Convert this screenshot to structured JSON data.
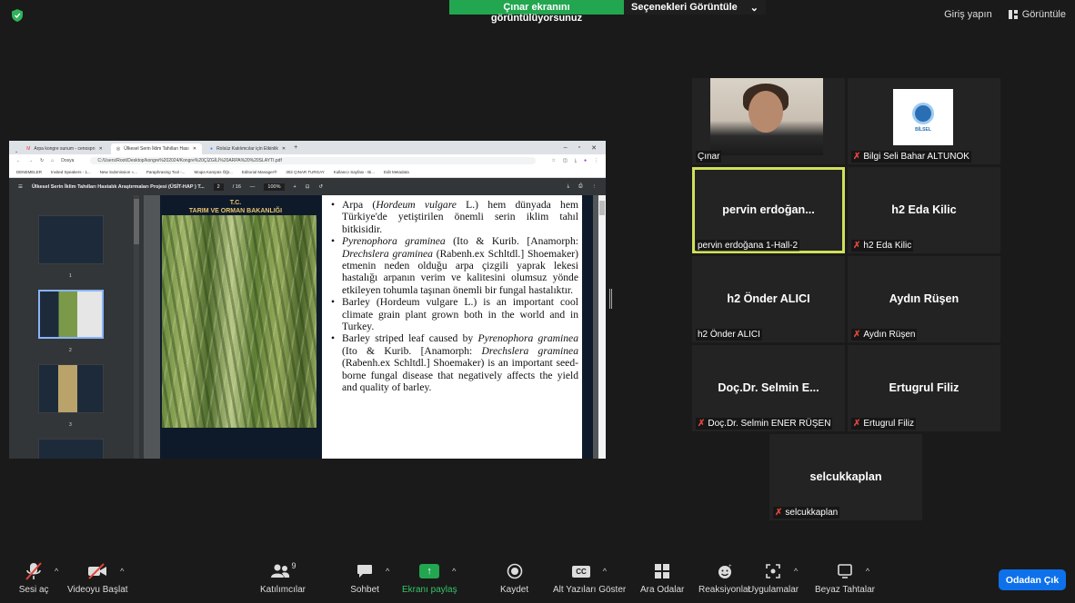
{
  "top": {
    "sharing_banner": "Çınar ekranını görüntülüyorsunuz",
    "view_options": "Seçenekleri Görüntüle",
    "sign_in": "Giriş yapın",
    "view": "Görüntüle"
  },
  "browser": {
    "tabs": [
      "Arpa kongre sunum - cenosprı",
      "Ülkesel Serin İklim Tahılları Hası",
      "Rolsüz Katılımcılar için Etkinlik"
    ],
    "address_label": "Dosya",
    "url": "C:/Users/Root/Desktop/kongre%202024/Kongre%20ÇİZGİLİ%20ARPA%20%20SLAYTI.pdf",
    "bookmarks": [
      "DENEMELER",
      "Invited Speakers - 1...",
      "New Submission «...",
      "Paraphrasing Tool -...",
      "Moqia Kampüs Öğr...",
      "Editorial Manager®",
      "302 ÇINAR TURGAY",
      "Kullanıcı Sayfası - Bi...",
      "Edit Metadata"
    ]
  },
  "pdf": {
    "title": "Ülkesel Serin İklim Tahılları Hastalık Araştırmaları Projesi (ÜSİT-HAP ) T...",
    "page": "2",
    "total": "/ 16",
    "zoom": "100%",
    "thumb_numbers": [
      "1",
      "2",
      "3"
    ]
  },
  "slide": {
    "header_line1": "T.C.",
    "header_line2": "TARIM VE ORMAN BAKANLIĞI",
    "bullets": [
      [
        "Arpa (",
        "Hordeum vulgare",
        " L.) hem dünyada hem Türkiye'de yetiştirilen önemli serin iklim tahıl bitkisidir."
      ],
      [
        "",
        "Pyrenophora graminea",
        " (Ito & Kurib. [Anamorph: ",
        "Drechslera graminea",
        " (Rabenh.ex Schltdl.] Shoemaker) etmenin neden olduğu arpa çizgili yaprak lekesi hastalığı arpanın verim ve kalitesini olumsuz yönde etkileyen tohumla taşınan önemli bir fungal hastalıktır."
      ],
      [
        "Barley (Hordeum vulgare L.) is an important cool climate grain plant grown both in the world and in Turkey."
      ],
      [
        "Barley striped leaf caused by ",
        "Pyrenophora graminea",
        " (Ito & Kurib. [Anamorph: ",
        "Drechslera graminea",
        " (Rabenh.ex Schltdl.] Shoemaker) is an important seed-borne fungal disease that negatively affects the yield and quality of barley."
      ]
    ]
  },
  "participants": [
    {
      "name": "",
      "label": "Çınar",
      "muted": false,
      "type": "video"
    },
    {
      "name": "",
      "label": "Bilgi Seli Bahar ALTUNOK",
      "muted": true,
      "type": "logo",
      "logo_text": "BİLSEL"
    },
    {
      "name": "pervin erdoğan...",
      "label": "pervin erdoğana 1-Hall-2",
      "muted": false,
      "type": "name",
      "speaking": true
    },
    {
      "name": "h2 Eda Kilic",
      "label": "h2 Eda Kilic",
      "muted": true,
      "type": "name"
    },
    {
      "name": "h2 Önder ALICI",
      "label": "h2 Önder ALICI",
      "muted": false,
      "type": "name"
    },
    {
      "name": "Aydın Rüşen",
      "label": "Aydın Rüşen",
      "muted": true,
      "type": "name"
    },
    {
      "name": "Doç.Dr. Selmin E...",
      "label": "Doç.Dr. Selmin ENER RÜŞEN",
      "muted": true,
      "type": "name"
    },
    {
      "name": "Ertugrul Filiz",
      "label": "Ertugrul Filiz",
      "muted": true,
      "type": "name"
    },
    {
      "name": "selcukkaplan",
      "label": "selcukkaplan",
      "muted": true,
      "type": "name"
    }
  ],
  "toolbar": {
    "audio": "Sesi aç",
    "video": "Videoyu Başlat",
    "participants": "Katılımcılar",
    "participant_count": "9",
    "chat": "Sohbet",
    "share": "Ekranı paylaş",
    "record": "Kaydet",
    "captions": "Alt Yazıları Göster",
    "captions_icon": "CC",
    "breakout": "Ara Odalar",
    "reactions": "Reaksiyonlar",
    "apps": "Uygulamalar",
    "whiteboards": "Beyaz Tahtalar",
    "leave": "Odadan Çık"
  },
  "colors": {
    "share_green": "#22a64f",
    "leave_blue": "#0e71eb",
    "speaking_border": "#d1e05a",
    "muted_red": "#e0453a"
  }
}
